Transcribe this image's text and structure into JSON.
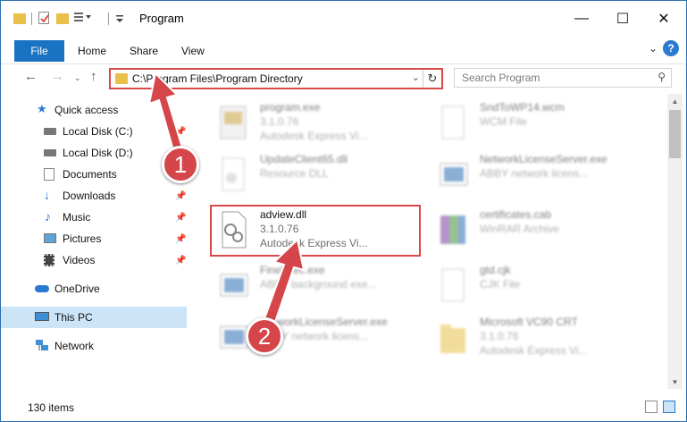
{
  "window": {
    "title": "Program",
    "controls": {
      "minimize": "—",
      "maximize": "☐",
      "close": "✕"
    }
  },
  "ribbon": {
    "tabs": [
      "File",
      "Home",
      "Share",
      "View"
    ],
    "toggle": "⌄",
    "help": "?"
  },
  "address": {
    "path": "C:\\Program Files\\Program Directory",
    "search_placeholder": "Search Program"
  },
  "sidebar": {
    "items": [
      {
        "label": "Quick access",
        "icon": "star-icon"
      },
      {
        "label": "Local Disk (C:)",
        "icon": "drive-icon",
        "pinned": true
      },
      {
        "label": "Local Disk (D:)",
        "icon": "drive-icon"
      },
      {
        "label": "Documents",
        "icon": "documents-icon",
        "pinned": true
      },
      {
        "label": "Downloads",
        "icon": "download-icon",
        "pinned": true
      },
      {
        "label": "Music",
        "icon": "music-icon",
        "pinned": true
      },
      {
        "label": "Pictures",
        "icon": "pictures-icon",
        "pinned": true
      },
      {
        "label": "Videos",
        "icon": "videos-icon",
        "pinned": true
      },
      {
        "label": "OneDrive",
        "icon": "cloud-icon"
      },
      {
        "label": "This PC",
        "icon": "computer-icon",
        "selected": true
      },
      {
        "label": "Network",
        "icon": "network-icon"
      }
    ]
  },
  "files": [
    {
      "name": "program.exe",
      "version": "3.1.0.76",
      "description": "Autodesk Express Vi..."
    },
    {
      "name": "SndToWP14.wcm",
      "version": "WCM File",
      "description": ""
    },
    {
      "name": "UpdateClient65.dll",
      "version": "Resource DLL",
      "description": ""
    },
    {
      "name": "NetworkLicenseServer.exe",
      "version": "ABBY network licens...",
      "description": ""
    },
    {
      "name": "adview.dll",
      "version": "3.1.0.76",
      "description": "Autodesk Express Vi..."
    },
    {
      "name": "certificates.cab",
      "version": "WinRAR Archive",
      "description": ""
    },
    {
      "name": "FineExec.exe",
      "version": "ABBY background exe...",
      "description": ""
    },
    {
      "name": "gtd.cjk",
      "version": "CJK File",
      "description": ""
    },
    {
      "name": "NetworkLicenseServer.exe",
      "version": "ABBY network licens...",
      "description": ""
    },
    {
      "name": "Microsoft VC90 CRT",
      "version": "3.1.0.76",
      "description": "Autodesk Express Vi..."
    }
  ],
  "status": {
    "items": "130 items"
  },
  "callouts": [
    "1",
    "2"
  ],
  "colors": {
    "accent": "#1a73c2",
    "highlight": "#d9494a",
    "selected": "#cce4f7"
  }
}
